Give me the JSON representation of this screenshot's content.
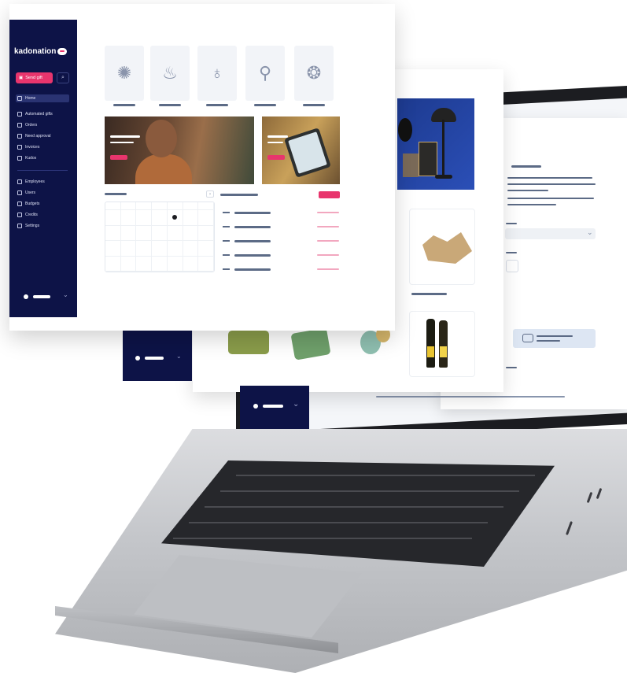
{
  "brand": {
    "logo": "kadonation",
    "accent": "#e8356d",
    "navy": "#0d1347"
  },
  "sidebar": {
    "send_gift_label": "Send gift",
    "search_icon": "search-icon",
    "items": [
      {
        "label": "Home",
        "icon": "home-icon",
        "active": true
      },
      {
        "label": "Automated gifts",
        "icon": "automation-icon"
      },
      {
        "label": "Orders",
        "icon": "orders-icon"
      },
      {
        "label": "Need approval",
        "icon": "approval-icon"
      },
      {
        "label": "Invoices",
        "icon": "invoice-icon"
      },
      {
        "label": "Kudos",
        "icon": "kudos-icon"
      }
    ],
    "items_secondary": [
      {
        "label": "Employees",
        "icon": "employees-icon"
      },
      {
        "label": "Users",
        "icon": "users-icon"
      },
      {
        "label": "Budgets",
        "icon": "budgets-icon"
      },
      {
        "label": "Credits",
        "icon": "credits-icon"
      },
      {
        "label": "Settings",
        "icon": "settings-icon"
      }
    ]
  },
  "occasions": [
    {
      "icon": "celebration-icon",
      "glyph": "✺"
    },
    {
      "icon": "cake-icon",
      "glyph": "♨"
    },
    {
      "icon": "baby-icon",
      "glyph": "♁"
    },
    {
      "icon": "ice-cream-icon",
      "glyph": "⚲"
    },
    {
      "icon": "award-icon",
      "glyph": "❂"
    }
  ],
  "calendar": {
    "nav_icon": "chevron-right-icon",
    "nav_glyph": "›"
  },
  "laptop": {
    "user_menu_chevron": "⌄"
  }
}
